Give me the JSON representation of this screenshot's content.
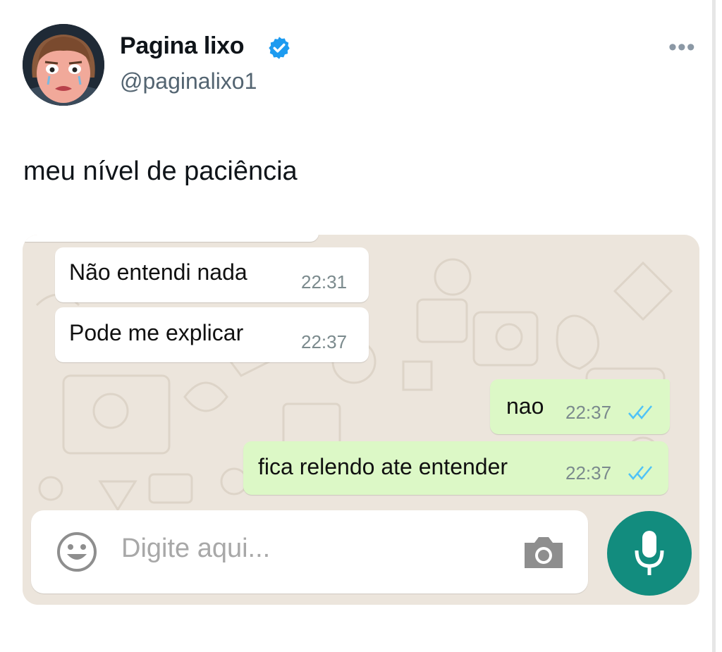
{
  "tweet": {
    "display_name": "Pagina lixo",
    "handle": "@paginalixo1",
    "text": "meu nível de paciência",
    "verified": true,
    "more_icon": "more-horizontal-icon"
  },
  "chat": {
    "messages": [
      {
        "direction": "incoming",
        "text": "Não entendi nada",
        "time": "22:31"
      },
      {
        "direction": "incoming",
        "text": "Pode me explicar",
        "time": "22:37"
      },
      {
        "direction": "outgoing",
        "text": "nao",
        "time": "22:37",
        "status": "read"
      },
      {
        "direction": "outgoing",
        "text": "fica relendo ate entender",
        "time": "22:37",
        "status": "read"
      }
    ],
    "input_placeholder": "Digite aqui...",
    "colors": {
      "wallpaper": "#ece5dc",
      "incoming_bubble": "#ffffff",
      "outgoing_bubble": "#dcf8c6",
      "mic_button": "#128c7e",
      "read_ticks": "#4fc3f7",
      "verified_badge": "#1d9bf0"
    }
  }
}
